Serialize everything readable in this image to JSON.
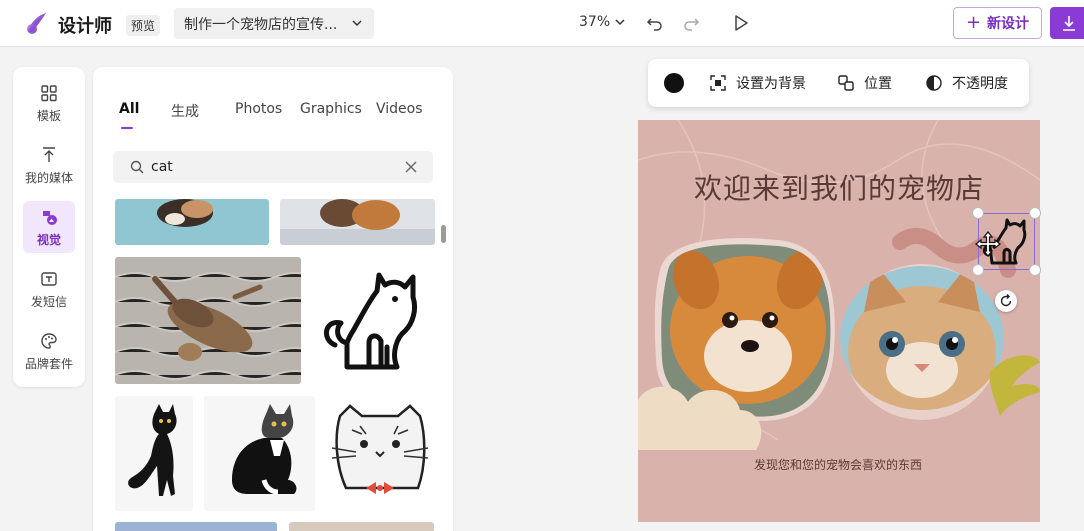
{
  "header": {
    "app_title": "设计师",
    "preview_badge": "预览",
    "document_title": "制作一个宠物店的宣传...",
    "zoom": "37%",
    "new_design_label": "新设计"
  },
  "rail": {
    "items": [
      {
        "label": "模板",
        "icon": "template-grid-icon"
      },
      {
        "label": "我的媒体",
        "icon": "upload-icon"
      },
      {
        "label": "视觉",
        "icon": "visual-shapes-icon",
        "active": true
      },
      {
        "label": "发短信",
        "icon": "text-icon"
      },
      {
        "label": "品牌套件",
        "icon": "palette-icon"
      }
    ]
  },
  "panel": {
    "tabs": [
      {
        "label": "All",
        "active": true
      },
      {
        "label": "生成"
      },
      {
        "label": "Photos"
      },
      {
        "label": "Graphics"
      },
      {
        "label": "Videos"
      }
    ],
    "search_value": "cat"
  },
  "toolbar": {
    "color": "#111111",
    "set_background": "设置为背景",
    "position": "位置",
    "opacity": "不透明度"
  },
  "canvas": {
    "title": "欢迎来到我们的宠物店",
    "subtitle": "发现您和您的宠物会喜欢的东西",
    "background_color": "#d9b3ab"
  },
  "colors": {
    "accent": "#8a3bd6",
    "text_dark": "#5a3a36"
  }
}
